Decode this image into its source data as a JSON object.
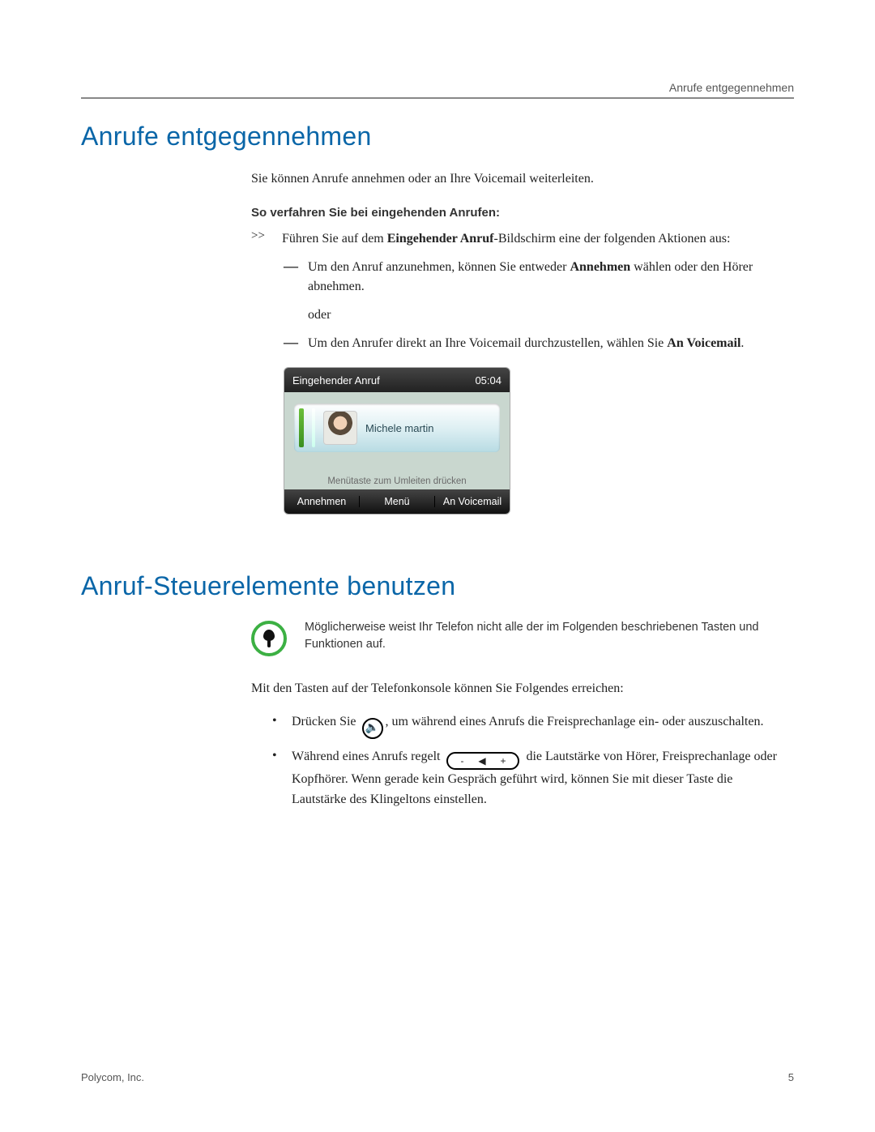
{
  "header": {
    "running_title": "Anrufe entgegennehmen"
  },
  "footer": {
    "company": "Polycom, Inc.",
    "page_number": "5"
  },
  "section1": {
    "title": "Anrufe entgegennehmen",
    "intro": "Sie können Anrufe annehmen oder an Ihre Voicemail weiterleiten.",
    "subheading": "So verfahren Sie bei eingehenden Anrufen:",
    "chev_mark": ">>",
    "chev_p1": "Führen Sie auf dem ",
    "chev_b1": "Eingehender Anruf",
    "chev_p2": "-Bildschirm eine der folgenden Aktionen aus:",
    "dash_mark": "—",
    "d1_p1": "Um den Anruf anzunehmen, können Sie entweder ",
    "d1_b1": "Annehmen",
    "d1_p2": " wählen oder den Hörer abnehmen.",
    "or_label": "oder",
    "d2_p1": "Um den Anrufer direkt an Ihre Voicemail durchzustellen, wählen Sie ",
    "d2_b1": "An Voicemail",
    "d2_p2": "."
  },
  "screenshot": {
    "title": "Eingehender Anruf",
    "time": "05:04",
    "caller": "Michele martin",
    "hint": "Menütaste zum Umleiten drücken",
    "btn_left": "Annehmen",
    "btn_mid": "Menü",
    "btn_right": "An Voicemail"
  },
  "section2": {
    "title": "Anruf-Steuerelemente benutzen",
    "note": "Möglicherweise weist Ihr Telefon nicht alle der im Folgenden beschriebenen Tasten und Funktionen auf.",
    "lead": "Mit den Tasten auf der Telefonkonsole können Sie Folgendes erreichen:",
    "dot": "•",
    "b1_p1": "Drücken Sie ",
    "b1_p2": ", um während eines Anrufs die Freisprechanlage ein- oder auszuschalten.",
    "b2_p1": "Während eines Anrufs regelt ",
    "b2_p2": " die Lautstärke von Hörer, Freisprechanlage oder Kopfhörer. Wenn gerade kein Gespräch geführt wird, können Sie mit dieser Taste die Lautstärke des Klingeltons einstellen.",
    "vol_minus": "-",
    "vol_plus": "+"
  }
}
